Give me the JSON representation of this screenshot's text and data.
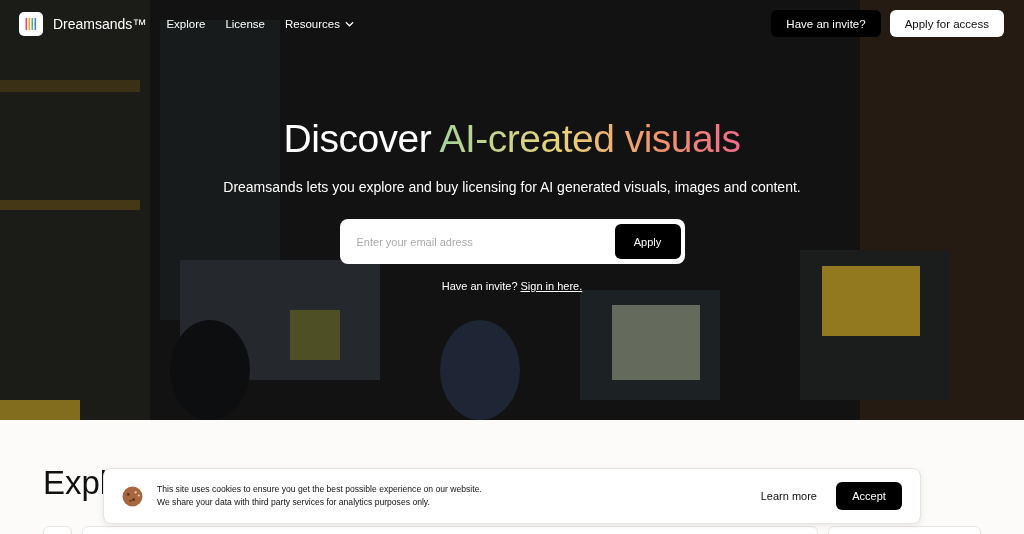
{
  "nav": {
    "brand": "Dreamsands™",
    "links": [
      {
        "label": "Explore",
        "kind": "link"
      },
      {
        "label": "License",
        "kind": "link"
      },
      {
        "label": "Resources",
        "kind": "dropdown"
      }
    ],
    "buttons": [
      {
        "label": "Have an invite?",
        "kind": "dark"
      },
      {
        "label": "Apply for access",
        "kind": "light"
      }
    ]
  },
  "hero": {
    "kind": "picture",
    "title_lead": "Discover",
    "title_highlight": "AI-created visuals",
    "subtitle": "Dreamsands lets you explore and buy licensing for AI generated visuals, images and content.",
    "email": {
      "placeholder": "Enter your email adress"
    },
    "apply_button": "Apply",
    "invite_text": "Have an invite?",
    "invite_link": "Sign in here."
  },
  "explore": {
    "heading": "Expl"
  },
  "cookie_banner": {
    "lines": [
      "This site uses cookies to ensure you get the best possible experience on our website.",
      "We share your data with third party services for analytics purposes only."
    ],
    "learn_more": "Learn more",
    "accept": "Accept"
  }
}
